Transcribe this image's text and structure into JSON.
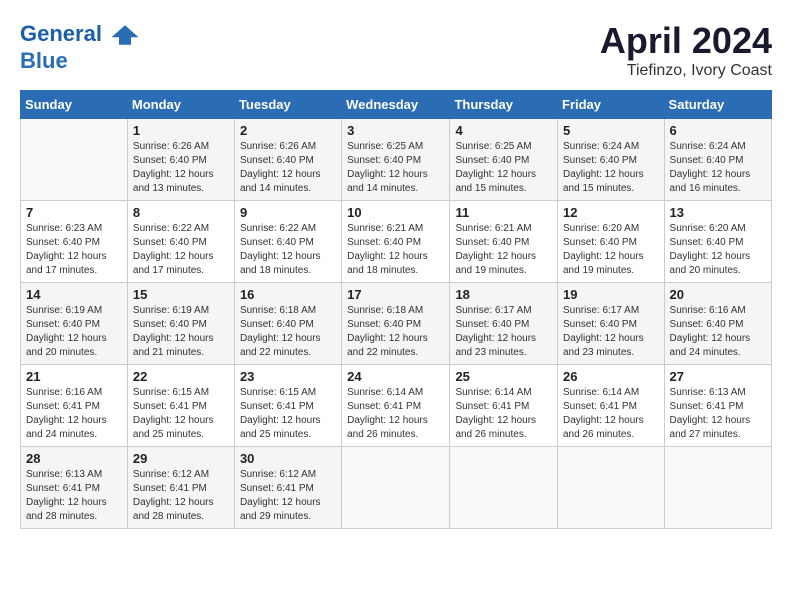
{
  "header": {
    "logo_line1": "General",
    "logo_line2": "Blue",
    "month": "April 2024",
    "location": "Tiefinzo, Ivory Coast"
  },
  "weekdays": [
    "Sunday",
    "Monday",
    "Tuesday",
    "Wednesday",
    "Thursday",
    "Friday",
    "Saturday"
  ],
  "weeks": [
    [
      {
        "day": "",
        "info": ""
      },
      {
        "day": "1",
        "info": "Sunrise: 6:26 AM\nSunset: 6:40 PM\nDaylight: 12 hours\nand 13 minutes."
      },
      {
        "day": "2",
        "info": "Sunrise: 6:26 AM\nSunset: 6:40 PM\nDaylight: 12 hours\nand 14 minutes."
      },
      {
        "day": "3",
        "info": "Sunrise: 6:25 AM\nSunset: 6:40 PM\nDaylight: 12 hours\nand 14 minutes."
      },
      {
        "day": "4",
        "info": "Sunrise: 6:25 AM\nSunset: 6:40 PM\nDaylight: 12 hours\nand 15 minutes."
      },
      {
        "day": "5",
        "info": "Sunrise: 6:24 AM\nSunset: 6:40 PM\nDaylight: 12 hours\nand 15 minutes."
      },
      {
        "day": "6",
        "info": "Sunrise: 6:24 AM\nSunset: 6:40 PM\nDaylight: 12 hours\nand 16 minutes."
      }
    ],
    [
      {
        "day": "7",
        "info": "Sunrise: 6:23 AM\nSunset: 6:40 PM\nDaylight: 12 hours\nand 17 minutes."
      },
      {
        "day": "8",
        "info": "Sunrise: 6:22 AM\nSunset: 6:40 PM\nDaylight: 12 hours\nand 17 minutes."
      },
      {
        "day": "9",
        "info": "Sunrise: 6:22 AM\nSunset: 6:40 PM\nDaylight: 12 hours\nand 18 minutes."
      },
      {
        "day": "10",
        "info": "Sunrise: 6:21 AM\nSunset: 6:40 PM\nDaylight: 12 hours\nand 18 minutes."
      },
      {
        "day": "11",
        "info": "Sunrise: 6:21 AM\nSunset: 6:40 PM\nDaylight: 12 hours\nand 19 minutes."
      },
      {
        "day": "12",
        "info": "Sunrise: 6:20 AM\nSunset: 6:40 PM\nDaylight: 12 hours\nand 19 minutes."
      },
      {
        "day": "13",
        "info": "Sunrise: 6:20 AM\nSunset: 6:40 PM\nDaylight: 12 hours\nand 20 minutes."
      }
    ],
    [
      {
        "day": "14",
        "info": "Sunrise: 6:19 AM\nSunset: 6:40 PM\nDaylight: 12 hours\nand 20 minutes."
      },
      {
        "day": "15",
        "info": "Sunrise: 6:19 AM\nSunset: 6:40 PM\nDaylight: 12 hours\nand 21 minutes."
      },
      {
        "day": "16",
        "info": "Sunrise: 6:18 AM\nSunset: 6:40 PM\nDaylight: 12 hours\nand 22 minutes."
      },
      {
        "day": "17",
        "info": "Sunrise: 6:18 AM\nSunset: 6:40 PM\nDaylight: 12 hours\nand 22 minutes."
      },
      {
        "day": "18",
        "info": "Sunrise: 6:17 AM\nSunset: 6:40 PM\nDaylight: 12 hours\nand 23 minutes."
      },
      {
        "day": "19",
        "info": "Sunrise: 6:17 AM\nSunset: 6:40 PM\nDaylight: 12 hours\nand 23 minutes."
      },
      {
        "day": "20",
        "info": "Sunrise: 6:16 AM\nSunset: 6:40 PM\nDaylight: 12 hours\nand 24 minutes."
      }
    ],
    [
      {
        "day": "21",
        "info": "Sunrise: 6:16 AM\nSunset: 6:41 PM\nDaylight: 12 hours\nand 24 minutes."
      },
      {
        "day": "22",
        "info": "Sunrise: 6:15 AM\nSunset: 6:41 PM\nDaylight: 12 hours\nand 25 minutes."
      },
      {
        "day": "23",
        "info": "Sunrise: 6:15 AM\nSunset: 6:41 PM\nDaylight: 12 hours\nand 25 minutes."
      },
      {
        "day": "24",
        "info": "Sunrise: 6:14 AM\nSunset: 6:41 PM\nDaylight: 12 hours\nand 26 minutes."
      },
      {
        "day": "25",
        "info": "Sunrise: 6:14 AM\nSunset: 6:41 PM\nDaylight: 12 hours\nand 26 minutes."
      },
      {
        "day": "26",
        "info": "Sunrise: 6:14 AM\nSunset: 6:41 PM\nDaylight: 12 hours\nand 26 minutes."
      },
      {
        "day": "27",
        "info": "Sunrise: 6:13 AM\nSunset: 6:41 PM\nDaylight: 12 hours\nand 27 minutes."
      }
    ],
    [
      {
        "day": "28",
        "info": "Sunrise: 6:13 AM\nSunset: 6:41 PM\nDaylight: 12 hours\nand 28 minutes."
      },
      {
        "day": "29",
        "info": "Sunrise: 6:12 AM\nSunset: 6:41 PM\nDaylight: 12 hours\nand 28 minutes."
      },
      {
        "day": "30",
        "info": "Sunrise: 6:12 AM\nSunset: 6:41 PM\nDaylight: 12 hours\nand 29 minutes."
      },
      {
        "day": "",
        "info": ""
      },
      {
        "day": "",
        "info": ""
      },
      {
        "day": "",
        "info": ""
      },
      {
        "day": "",
        "info": ""
      }
    ]
  ]
}
